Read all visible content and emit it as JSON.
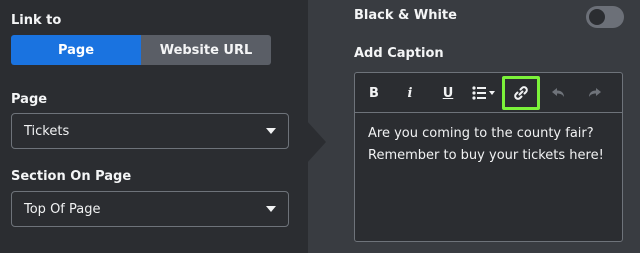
{
  "left_panel": {
    "link_to_label": "Link to",
    "link_options": [
      "Page",
      "Website URL"
    ],
    "selected_link_option": "Page",
    "page_label": "Page",
    "page_value": "Tickets",
    "section_label": "Section On Page",
    "section_value": "Top Of Page"
  },
  "right_panel": {
    "black_white_label": "Black & White",
    "black_white_on": false,
    "caption_label": "Add Caption",
    "toolbar": {
      "bold": "B",
      "italic": "i",
      "underline": "U",
      "list_icon": "bullet-list-icon",
      "link_icon": "link-icon",
      "undo_icon": "undo-icon",
      "redo_icon": "redo-icon"
    },
    "caption_lines": [
      "Are you coming to the county fair?",
      "Remember to buy your tickets here!"
    ]
  },
  "colors": {
    "accent": "#1a73e0",
    "highlight": "#7cf23a"
  }
}
